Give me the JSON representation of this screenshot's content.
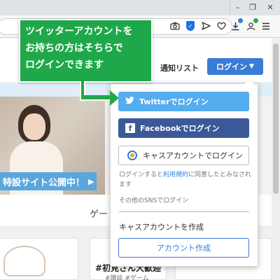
{
  "browser": {
    "window_controls": [
      "–",
      "❐",
      "✕"
    ],
    "url_icons": [
      "camera-icon",
      "shield-icon",
      "send-icon",
      "heart-icon"
    ],
    "ext_icons": [
      "download-icon",
      "profile-icon",
      "menu-icon"
    ]
  },
  "header": {
    "nav_link": "通知リスト",
    "login_button": "ログイン"
  },
  "hero": {
    "banner": "特設サイト公開中！"
  },
  "section": {
    "label": "ゲー"
  },
  "card": {
    "title": "#初見さん大歓迎",
    "subtitle": "#雑談 #ゲーム"
  },
  "login_dropdown": {
    "twitter_label": "Twitterでログイン",
    "facebook_label": "Facebookでログイン",
    "cas_label": "キャスアカウントでログイン",
    "terms_pre": "ログインすると",
    "terms_link": "利用規約",
    "terms_post": "に同意したとみなされます",
    "other_sns": "その他のSNSでログイン",
    "create_label": "キャスアカウントを作成",
    "create_button": "アカウント作成"
  },
  "callout": {
    "lines": [
      "ツイッターアカウントを",
      "お持ちの方はそちらで",
      "ログインできます"
    ]
  },
  "colors": {
    "twitter": "#55acee",
    "facebook": "#3b5998",
    "accent": "#3a7bd5",
    "callout": "#1fa84a"
  }
}
